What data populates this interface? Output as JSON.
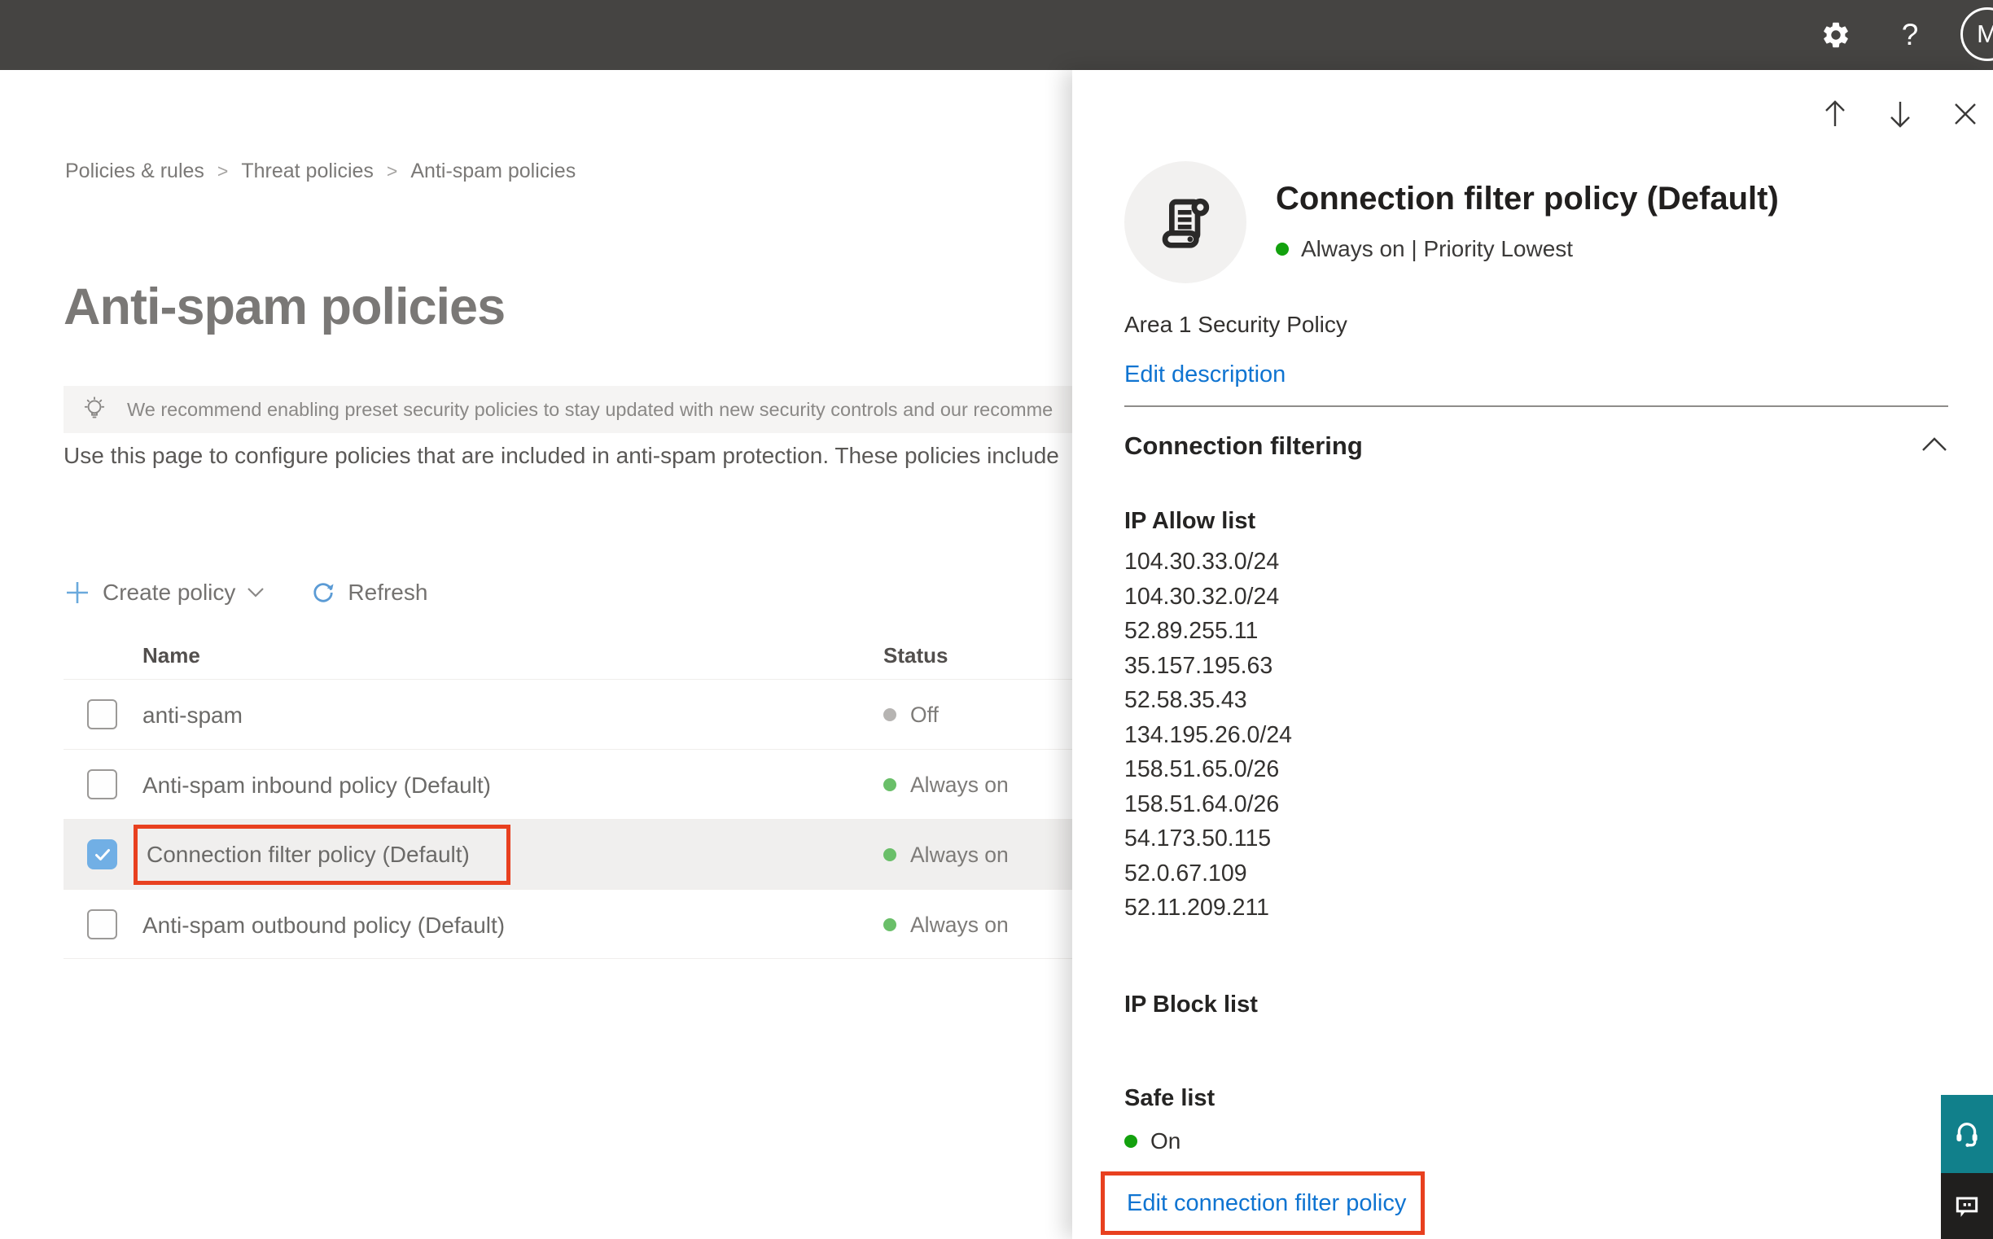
{
  "topbar": {
    "help_label": "?",
    "avatar_initial": "M"
  },
  "breadcrumb": {
    "separator": ">",
    "items": [
      "Policies & rules",
      "Threat policies",
      "Anti-spam policies"
    ]
  },
  "page": {
    "title": "Anti-spam policies",
    "banner_text": "We recommend enabling preset security policies to stay updated with new security controls and our recomme",
    "description": "Use this page to configure policies that are included in anti-spam protection. These policies include",
    "toolbar": {
      "create_label": "Create policy",
      "refresh_label": "Refresh"
    },
    "table": {
      "columns": [
        "Name",
        "Status"
      ],
      "rows": [
        {
          "name": "anti-spam",
          "status": "Off",
          "status_color": "gray",
          "checked": false,
          "selected": false
        },
        {
          "name": "Anti-spam inbound policy (Default)",
          "status": "Always on",
          "status_color": "green",
          "checked": false,
          "selected": false
        },
        {
          "name": "Connection filter policy (Default)",
          "status": "Always on",
          "status_color": "green",
          "checked": true,
          "selected": true,
          "annotated": true
        },
        {
          "name": "Anti-spam outbound policy (Default)",
          "status": "Always on",
          "status_color": "green",
          "checked": false,
          "selected": false
        }
      ]
    }
  },
  "panel": {
    "title": "Connection filter policy (Default)",
    "status_line": "Always on | Priority Lowest",
    "description": "Area 1 Security Policy",
    "edit_description_label": "Edit description",
    "section_title": "Connection filtering",
    "ip_allow": {
      "label": "IP Allow list",
      "items": [
        "104.30.33.0/24",
        "104.30.32.0/24",
        "52.89.255.11",
        "35.157.195.63",
        "52.58.35.43",
        "134.195.26.0/24",
        "158.51.65.0/26",
        "158.51.64.0/26",
        "54.173.50.115",
        "52.0.67.109",
        "52.11.209.211"
      ]
    },
    "ip_block": {
      "label": "IP Block list"
    },
    "safe_list": {
      "label": "Safe list",
      "status": "On"
    },
    "edit_link_label": "Edit connection filter policy"
  },
  "colors": {
    "topbar_bg": "#454442",
    "accent_blue_link": "#0f74d1",
    "toolbar_icon_blue": "#6aa9dc",
    "status_green_table": "#6abf69",
    "status_green_panel": "#13a10e",
    "status_gray": "#b6b4b2",
    "annotation_red": "#e8401f",
    "checked_checkbox_blue": "#71afe5",
    "help_button_teal": "#11808b",
    "feedback_button_dark": "#201f1e",
    "selected_row_bg": "#f0efee",
    "banner_bg": "#f5f4f3"
  }
}
